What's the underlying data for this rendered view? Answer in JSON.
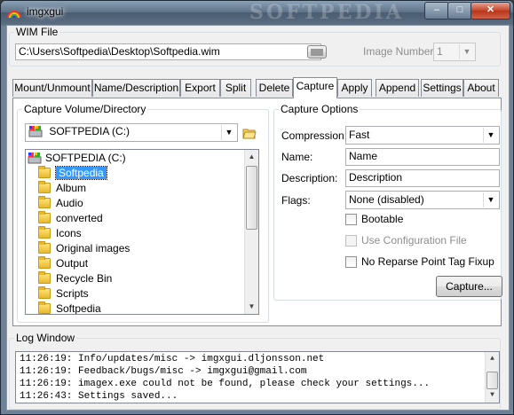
{
  "window": {
    "title": "imgxgui",
    "watermark": "SOFTPEDIA",
    "controls": {
      "minimize": "–",
      "maximize": "□",
      "close": "✕"
    }
  },
  "wim_file": {
    "label": "WIM File",
    "path": "C:\\Users\\Softpedia\\Desktop\\Softpedia.wim",
    "image_number_label": "Image Number:",
    "image_number": "1"
  },
  "tabs": [
    {
      "label": "Mount/Unmount"
    },
    {
      "label": "Name/Description"
    },
    {
      "label": "Export"
    },
    {
      "label": "Split"
    },
    {
      "label": "Delete"
    },
    {
      "label": "Capture",
      "active": true
    },
    {
      "label": "Apply"
    },
    {
      "label": "Append"
    },
    {
      "label": "Settings"
    },
    {
      "label": "About"
    }
  ],
  "capture_volume": {
    "label": "Capture Volume/Directory",
    "drive_selected": "SOFTPEDIA (C:)",
    "tree_root": "SOFTPEDIA (C:)",
    "tree_items": [
      "Softpedia",
      "Album",
      "Audio",
      "converted",
      "Icons",
      "Original images",
      "Output",
      "Recycle Bin",
      "Scripts",
      "Softpedia"
    ],
    "selected_index": 0
  },
  "capture_options": {
    "label": "Capture Options",
    "compression_label": "Compression:",
    "compression_value": "Fast",
    "name_label": "Name:",
    "name_value": "Name",
    "description_label": "Description:",
    "description_value": "Description",
    "flags_label": "Flags:",
    "flags_value": "None (disabled)",
    "bootable_label": "Bootable",
    "use_config_label": "Use Configuration File",
    "no_reparse_label": "No Reparse Point Tag Fixup",
    "capture_button": "Capture..."
  },
  "log": {
    "label": "Log Window",
    "lines": [
      "11:26:19: Info/updates/misc -> imgxgui.dljonsson.net",
      "11:26:19: Feedback/bugs/misc -> imgxgui@gmail.com",
      "11:26:19: imagex.exe could not be found, please check your settings...",
      "11:26:43: Settings saved..."
    ]
  },
  "colors": {
    "selection": "#3399ff",
    "title_bar": "#5e7287",
    "close_button": "#c4442a"
  }
}
